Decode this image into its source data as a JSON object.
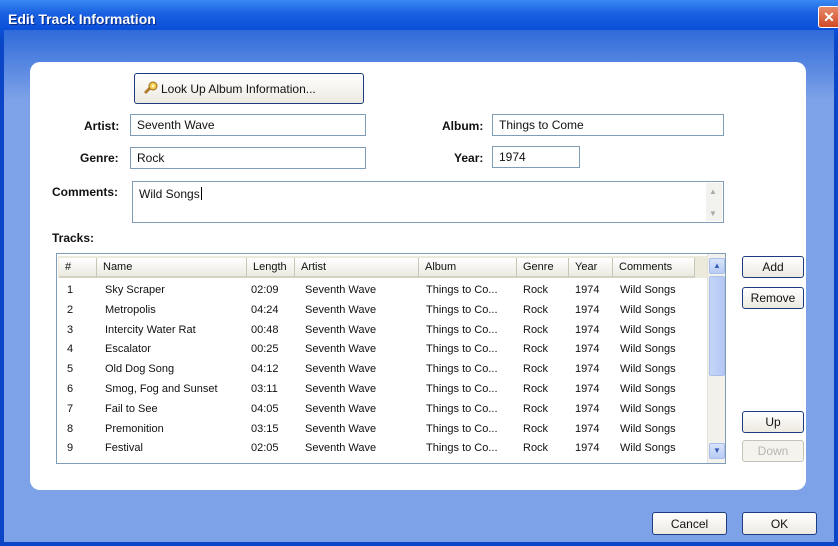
{
  "window": {
    "title": "Edit Track Information",
    "close_glyph": "✕"
  },
  "lookup_button": {
    "label": "Look Up Album Information...",
    "icon": "album-lookup-icon"
  },
  "fields": {
    "artist": {
      "label": "Artist:",
      "value": "Seventh Wave"
    },
    "album": {
      "label": "Album:",
      "value": "Things to Come"
    },
    "genre": {
      "label": "Genre:",
      "value": "Rock"
    },
    "year": {
      "label": "Year:",
      "value": "1974"
    },
    "comments": {
      "label": "Comments:",
      "value": "Wild Songs"
    }
  },
  "tracks": {
    "label": "Tracks:",
    "columns": [
      "#",
      "Name",
      "Length",
      "Artist",
      "Album",
      "Genre",
      "Year",
      "Comments"
    ],
    "rows": [
      [
        "1",
        "Sky Scraper",
        "02:09",
        "Seventh Wave",
        "Things to Co...",
        "Rock",
        "1974",
        "Wild Songs"
      ],
      [
        "2",
        "Metropolis",
        "04:24",
        "Seventh Wave",
        "Things to Co...",
        "Rock",
        "1974",
        "Wild Songs"
      ],
      [
        "3",
        "Intercity Water Rat",
        "00:48",
        "Seventh Wave",
        "Things to Co...",
        "Rock",
        "1974",
        "Wild Songs"
      ],
      [
        "4",
        "Escalator",
        "00:25",
        "Seventh Wave",
        "Things to Co...",
        "Rock",
        "1974",
        "Wild Songs"
      ],
      [
        "5",
        "Old Dog Song",
        "04:12",
        "Seventh Wave",
        "Things to Co...",
        "Rock",
        "1974",
        "Wild Songs"
      ],
      [
        "6",
        "Smog, Fog and Sunset",
        "03:11",
        "Seventh Wave",
        "Things to Co...",
        "Rock",
        "1974",
        "Wild Songs"
      ],
      [
        "7",
        "Fail to See",
        "04:05",
        "Seventh Wave",
        "Things to Co...",
        "Rock",
        "1974",
        "Wild Songs"
      ],
      [
        "8",
        "Premonition",
        "03:15",
        "Seventh Wave",
        "Things to Co...",
        "Rock",
        "1974",
        "Wild Songs"
      ],
      [
        "9",
        "Festival",
        "02:05",
        "Seventh Wave",
        "Things to Co...",
        "Rock",
        "1974",
        "Wild Songs"
      ]
    ]
  },
  "side_buttons": {
    "add": "Add",
    "remove": "Remove",
    "up": "Up",
    "down": "Down"
  },
  "footer": {
    "cancel": "Cancel",
    "ok": "OK"
  },
  "colors": {
    "title_bar": "#0a4fd8",
    "frame": "#0b45c8",
    "client": "#7ea2e8",
    "close": "#d04a26"
  }
}
